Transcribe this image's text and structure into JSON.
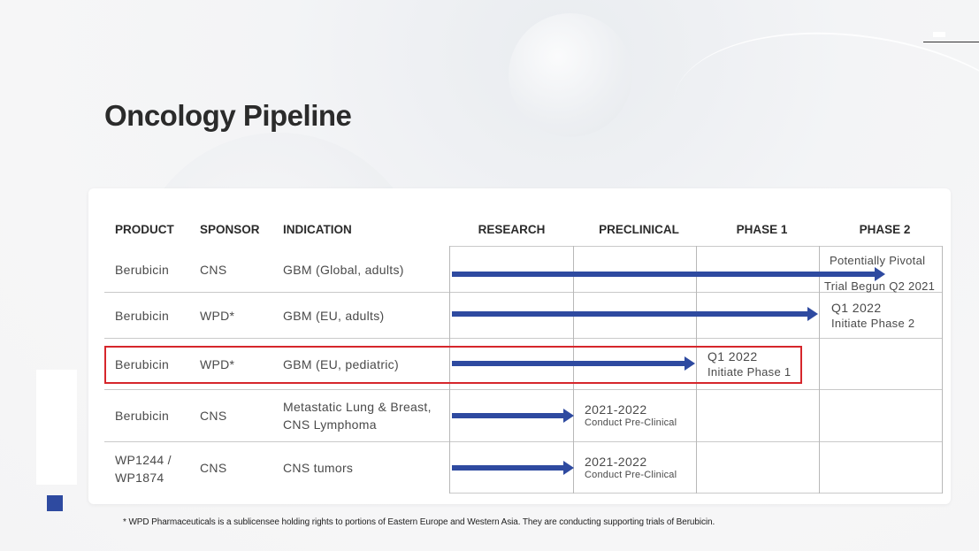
{
  "title": "Oncology Pipeline",
  "columns": {
    "product": "PRODUCT",
    "sponsor": "SPONSOR",
    "indication": "INDICATION",
    "research": "RESEARCH",
    "preclinical": "PRECLINICAL",
    "phase1": "PHASE 1",
    "phase2": "PHASE 2"
  },
  "rows": [
    {
      "product": [
        "Berubicin"
      ],
      "sponsor": "CNS",
      "indication": [
        "GBM (Global, adults)"
      ],
      "stage_reached": "phase2",
      "milestone": [
        "Potentially Pivotal",
        "Trial Begun Q2 2021"
      ],
      "highlighted": false
    },
    {
      "product": [
        "Berubicin"
      ],
      "sponsor": "WPD*",
      "indication": [
        "GBM (EU, adults)"
      ],
      "stage_reached": "phase2",
      "milestone": [
        "Q1 2022",
        "Initiate Phase 2"
      ],
      "highlighted": false
    },
    {
      "product": [
        "Berubicin"
      ],
      "sponsor": "WPD*",
      "indication": [
        "GBM (EU, pediatric)"
      ],
      "stage_reached": "phase1",
      "milestone": [
        "Q1 2022",
        "Initiate Phase 1"
      ],
      "highlighted": true
    },
    {
      "product": [
        "Berubicin"
      ],
      "sponsor": "CNS",
      "indication": [
        "Metastatic Lung & Breast,",
        "CNS Lymphoma"
      ],
      "stage_reached": "preclinical",
      "milestone": [
        "2021-2022",
        "Conduct Pre-Clinical"
      ],
      "highlighted": false
    },
    {
      "product": [
        "WP1244 /",
        "WP1874"
      ],
      "sponsor": "CNS",
      "indication": [
        "CNS tumors"
      ],
      "stage_reached": "preclinical",
      "milestone": [
        "2021-2022",
        "Conduct Pre-Clinical"
      ],
      "highlighted": false
    }
  ],
  "footnote": "* WPD Pharmaceuticals is a sublicensee holding rights to portions of Eastern Europe and Western Asia. They are conducting supporting trials of Berubicin.",
  "colors": {
    "arrow": "#2e4aa0",
    "highlight_border": "#d6262b",
    "accent_square": "#2e4aa0"
  }
}
